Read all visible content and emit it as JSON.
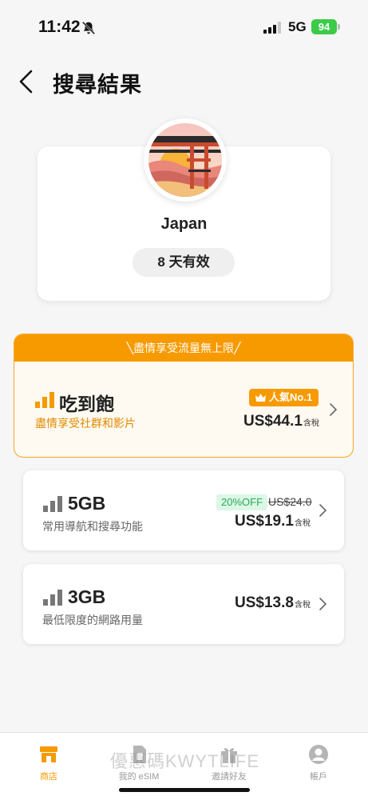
{
  "status_bar": {
    "time": "11:42",
    "network": "5G",
    "battery": "94"
  },
  "header": {
    "title": "搜尋結果"
  },
  "country": {
    "name": "Japan",
    "validity": "8 天有效"
  },
  "featured_banner": "╲盡情享受流量無上限╱",
  "plans": [
    {
      "name": "吃到飽",
      "description": "盡情享受社群和影片",
      "price": "US$44.1",
      "tax_label": "含稅",
      "badge": "人氣No.1"
    },
    {
      "name": "5GB",
      "description": "常用導航和搜尋功能",
      "price": "US$19.1",
      "tax_label": "含稅",
      "discount": "20%OFF",
      "original_price": "US$24.0"
    },
    {
      "name": "3GB",
      "description": "最低限度的網路用量",
      "price": "US$13.8",
      "tax_label": "含稅"
    }
  ],
  "tabs": [
    {
      "label": "商店",
      "icon": "store-icon",
      "active": true
    },
    {
      "label": "我的 eSIM",
      "icon": "sim-card-icon",
      "active": false
    },
    {
      "label": "邀請好友",
      "icon": "gift-icon",
      "active": false
    },
    {
      "label": "帳戶",
      "icon": "account-icon",
      "active": false
    }
  ],
  "watermark": "優惠碼KWYTLIFE",
  "colors": {
    "accent": "#f79a00",
    "discount_green": "#2aa85a",
    "battery_green": "#3ccb48"
  }
}
